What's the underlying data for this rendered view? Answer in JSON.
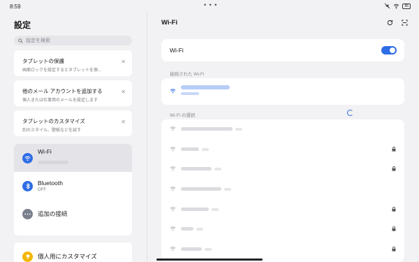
{
  "status_bar": {
    "time": "8:59",
    "dots": "• • •",
    "battery": "85"
  },
  "left": {
    "title": "設定",
    "search_placeholder": "設定を検索",
    "suggestions": [
      {
        "title": "タブレットの保護",
        "subtitle": "画面ロックを設定するとタブレットを保..."
      },
      {
        "title": "他のメール アカウントを追加する",
        "subtitle": "個人または仕事用のメールを設定します"
      },
      {
        "title": "タブレットのカスタマイズ",
        "subtitle": "別のスタイル、壁紙などを試す"
      }
    ],
    "items": [
      {
        "label": "Wi-Fi",
        "sub": ""
      },
      {
        "label": "Bluetooth",
        "sub": "OFF"
      },
      {
        "label": "追加の接続",
        "sub": ""
      }
    ],
    "customize": "個人用にカスタマイズ"
  },
  "right": {
    "title": "Wi-Fi",
    "master_label": "Wi-Fi",
    "master_on": true,
    "connected_label": "接続された Wi-Fi",
    "select_label": "Wi-Fi の選択",
    "networks": [
      {
        "locked": false
      },
      {
        "locked": true
      },
      {
        "locked": true
      },
      {
        "locked": false
      },
      {
        "locked": true
      },
      {
        "locked": true
      },
      {
        "locked": true
      }
    ]
  },
  "colors": {
    "accent": "#2f6de6",
    "background": "#f2f2f4"
  }
}
